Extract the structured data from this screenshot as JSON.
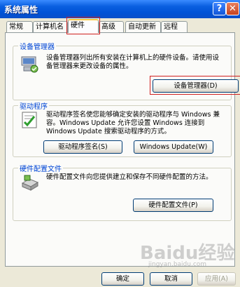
{
  "window": {
    "title": "系统属性"
  },
  "titlebar": {
    "help": "?",
    "close": "✕"
  },
  "tabs": [
    {
      "label": "常规"
    },
    {
      "label": "计算机名"
    },
    {
      "label": "硬件"
    },
    {
      "label": "高级"
    },
    {
      "label": "自动更新"
    },
    {
      "label": "远程"
    }
  ],
  "device_manager": {
    "heading": "设备管理器",
    "description": "设备管理器列出所有安装在计算机上的硬件设备。请使用设备管理器来更改设备的属性。",
    "button": "设备管理器(D)"
  },
  "drivers": {
    "heading": "驱动程序",
    "description": "驱动程序签名使您能够确定安装的驱动程序与 Windows 兼容。Windows Update 允许您设置 Windows 连接到 Windows Update 搜索驱动程序的方式。",
    "signing_button": "驱动程序签名(S)",
    "update_button": "Windows Update(W)"
  },
  "hw_profiles": {
    "heading": "硬件配置文件",
    "description": "硬件配置文件向您提供建立和保存不同硬件配置的方法。",
    "button": "硬件配置文件(P)"
  },
  "footer": {
    "ok": "确定",
    "cancel": "取消",
    "apply": "应用(A)"
  },
  "watermark": {
    "logo": "Baidu经验",
    "url": "jingyan.baidu.com"
  }
}
